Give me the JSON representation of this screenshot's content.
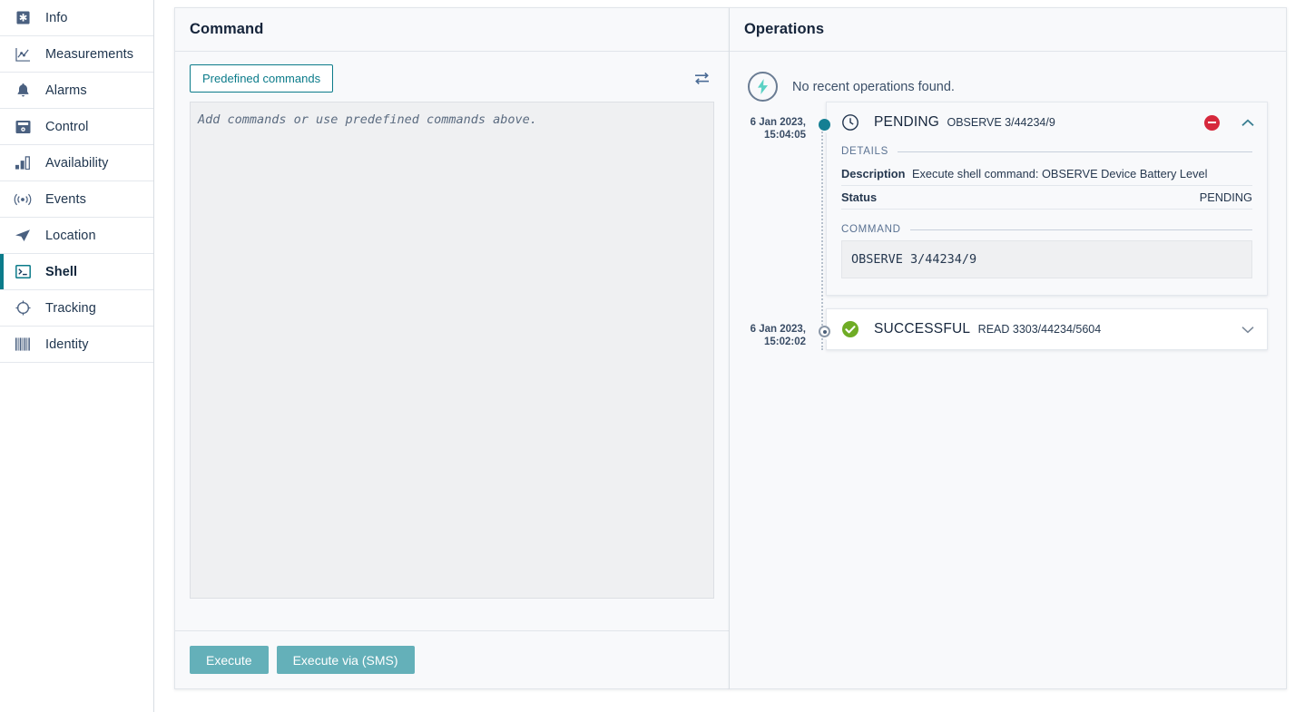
{
  "sidebar": {
    "items": [
      {
        "label": "Info",
        "icon": "asterisk-icon",
        "active": false
      },
      {
        "label": "Measurements",
        "icon": "chart-line-icon",
        "active": false
      },
      {
        "label": "Alarms",
        "icon": "bell-icon",
        "active": false
      },
      {
        "label": "Control",
        "icon": "control-device-icon",
        "active": false
      },
      {
        "label": "Availability",
        "icon": "bar-chart-icon",
        "active": false
      },
      {
        "label": "Events",
        "icon": "broadcast-icon",
        "active": false
      },
      {
        "label": "Location",
        "icon": "navigation-arrow-icon",
        "active": false
      },
      {
        "label": "Shell",
        "icon": "terminal-icon",
        "active": true
      },
      {
        "label": "Tracking",
        "icon": "crosshair-icon",
        "active": false
      },
      {
        "label": "Identity",
        "icon": "barcode-icon",
        "active": false
      }
    ]
  },
  "command_panel": {
    "title": "Command",
    "predefined_button": "Predefined commands",
    "swap_icon": "transfer-arrows-icon",
    "textarea_placeholder": "Add commands or use predefined commands above.",
    "textarea_value": "",
    "execute_button": "Execute",
    "execute_sms_button": "Execute via (SMS)"
  },
  "operations_panel": {
    "title": "Operations",
    "empty_state": {
      "icon": "lightning-bolt-icon",
      "text": "No recent operations found."
    },
    "operations": [
      {
        "timestamp_date": "6 Jan 2023,",
        "timestamp_time": "15:04:05",
        "status": "PENDING",
        "status_icon": "clock-icon",
        "summary": "OBSERVE 3/44234/9",
        "expanded": true,
        "cancel_icon": "cancel-circle-icon",
        "chevron": "chevron-up-icon",
        "details_label": "DETAILS",
        "details": [
          {
            "key": "Description",
            "value": "Execute shell command: OBSERVE Device Battery Level",
            "align": "left"
          },
          {
            "key": "Status",
            "value": "PENDING",
            "align": "right"
          }
        ],
        "command_label": "COMMAND",
        "command_code": "OBSERVE 3/44234/9"
      },
      {
        "timestamp_date": "6 Jan 2023,",
        "timestamp_time": "15:02:02",
        "status": "SUCCESSFUL",
        "status_icon": "check-circle-icon",
        "summary": "READ 3303/44234/5604",
        "expanded": false,
        "chevron": "chevron-down-icon"
      }
    ]
  },
  "colors": {
    "accent_teal": "#0b7b8a",
    "button_teal": "#64b0b9",
    "danger_red": "#d6283c",
    "success_green": "#6fac25",
    "panel_bg": "#f8f9fb",
    "text_dark": "#17273d"
  }
}
